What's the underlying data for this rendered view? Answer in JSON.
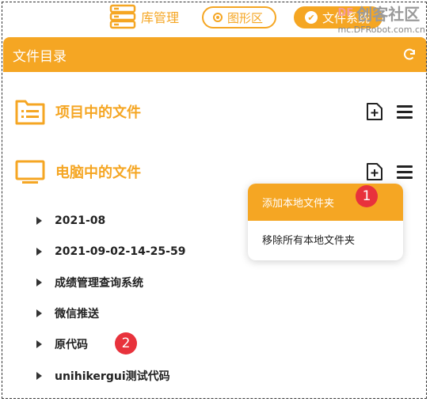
{
  "topbar": {
    "library_label": "库管理",
    "graph_label": "图形区",
    "file_label": "文件系统"
  },
  "watermark": {
    "brand": "创客社区",
    "brand_prefix": "DF",
    "url": "mc.DFRobot.com.cn"
  },
  "header": {
    "title": "文件目录"
  },
  "sections": {
    "project": {
      "title": "项目中的文件"
    },
    "computer": {
      "title": "电脑中的文件"
    }
  },
  "dropdown": {
    "items": [
      {
        "label": "添加本地文件夹"
      },
      {
        "label": "移除所有本地文件夹"
      }
    ]
  },
  "badges": {
    "one": "1",
    "two": "2"
  },
  "tree": {
    "items": [
      {
        "label": "2021-08"
      },
      {
        "label": "2021-09-02-14-25-59"
      },
      {
        "label": "成绩管理查询系统"
      },
      {
        "label": "微信推送"
      },
      {
        "label": "原代码"
      },
      {
        "label": "unihikergui测试代码"
      }
    ]
  },
  "colors": {
    "accent": "#f5a623",
    "badge": "#e8323c"
  }
}
